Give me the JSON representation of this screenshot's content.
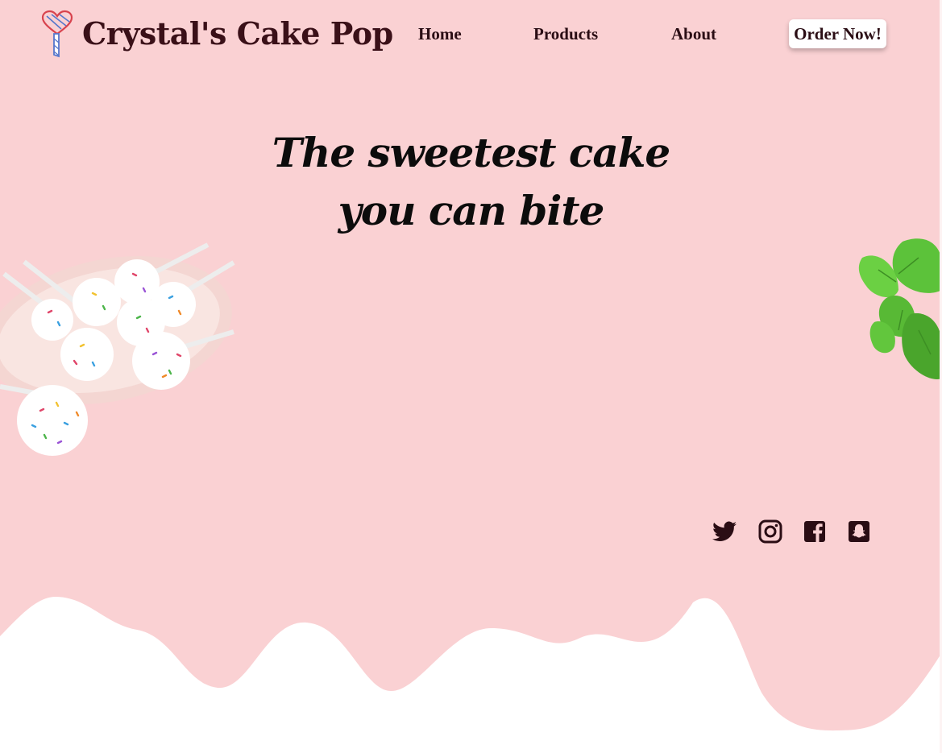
{
  "header": {
    "brand": "Crystal's Cake Pop",
    "logo_icon": "heart-lollipop-icon",
    "nav": [
      {
        "label": "Home"
      },
      {
        "label": "Products"
      },
      {
        "label": "About"
      }
    ],
    "cta_label": "Order Now!"
  },
  "hero": {
    "line1": "The sweetest cake",
    "line2": "you can bite"
  },
  "images": {
    "left": "cake-pops-plate-image",
    "right": "mint-leaves-image"
  },
  "social": [
    {
      "icon": "twitter-icon"
    },
    {
      "icon": "instagram-icon"
    },
    {
      "icon": "facebook-icon"
    },
    {
      "icon": "snapchat-icon"
    }
  ],
  "colors": {
    "background": "#fad1d3",
    "text_dark": "#2a0d14",
    "wave": "#ffffff"
  }
}
